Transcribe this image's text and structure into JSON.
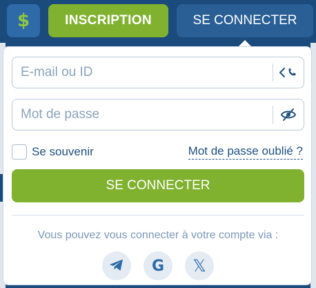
{
  "topbar": {
    "currency_icon": "dollar-icon",
    "currency_glyph": "$",
    "register_label": "INSCRIPTION",
    "login_label": "SE CONNECTER"
  },
  "login_form": {
    "email": {
      "placeholder": "E-mail ou ID",
      "value": "",
      "toggle_icon": "phone-switch-icon"
    },
    "password": {
      "placeholder": "Mot de passe",
      "value": "",
      "toggle_icon": "eye-slash-icon"
    },
    "remember_label": "Se souvenir",
    "remember_checked": false,
    "forgot_label": "Mot de passe oublié ?",
    "submit_label": "SE CONNECTER",
    "social_text": "Vous pouvez vous connecter à votre compte via :",
    "socials": [
      {
        "icon": "telegram-icon"
      },
      {
        "icon": "google-icon",
        "glyph": "G"
      },
      {
        "icon": "x-icon",
        "glyph": "𝕏"
      }
    ]
  },
  "colors": {
    "header_bg": "#1a4b7c",
    "primary_green": "#80b12f",
    "secondary_blue": "#2a5f96",
    "link_blue": "#1f4f80",
    "placeholder": "#8aa3bc"
  }
}
